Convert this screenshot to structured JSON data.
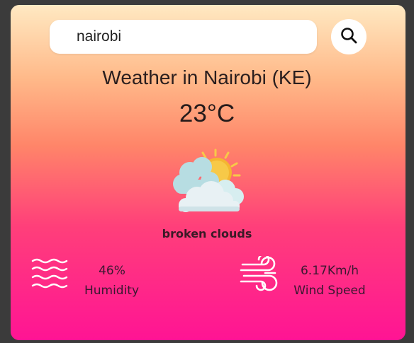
{
  "search": {
    "value": "nairobi",
    "button_icon": "search-icon"
  },
  "weather": {
    "title": "Weather in Nairobi (KE)",
    "temperature": "23°C",
    "icon": "cloud-sun-icon",
    "description": "broken clouds"
  },
  "humidity": {
    "icon": "waves-icon",
    "value": "46%",
    "label": "Humidity"
  },
  "wind": {
    "icon": "wind-icon",
    "value": "6.17Km/h",
    "label": "Wind Speed"
  },
  "colors": {
    "page_background": "#3b3b3b",
    "gradient_top": "#ffe9c2",
    "gradient_mid": "#ff8569",
    "gradient_bottom": "#ff1494",
    "text": "#2a1e1e"
  }
}
